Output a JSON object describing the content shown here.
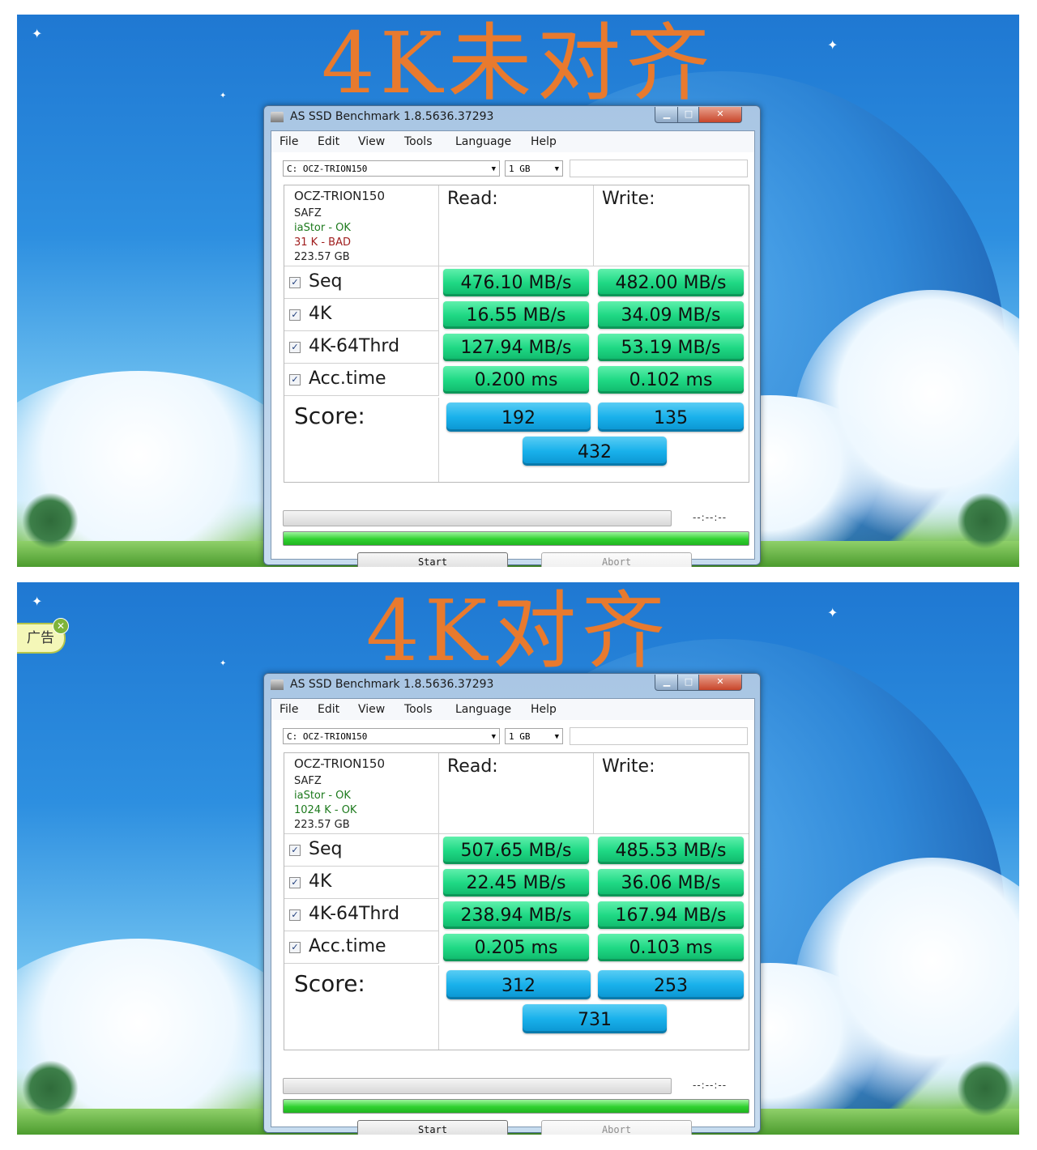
{
  "panels": [
    {
      "banner": "4K未对齐",
      "window": {
        "title": "AS SSD Benchmark 1.8.5636.37293",
        "menu": [
          "File",
          "Edit",
          "View",
          "Tools",
          "Language",
          "Help"
        ],
        "drive_select": "C: OCZ-TRION150",
        "size_select": "1 GB",
        "info": [
          "OCZ-TRION150",
          "SAFZ",
          "iaStor - OK",
          "31 K - BAD",
          "223.57 GB"
        ],
        "info_colors": [
          "#222222",
          "#222222",
          "#1d7a1d",
          "#a01e1e",
          "#222222"
        ],
        "read_header": "Read:",
        "write_header": "Write:",
        "rows": [
          {
            "label": "Seq",
            "read": "476.10 MB/s",
            "write": "482.00 MB/s"
          },
          {
            "label": "4K",
            "read": "16.55 MB/s",
            "write": "34.09 MB/s"
          },
          {
            "label": "4K-64Thrd",
            "read": "127.94 MB/s",
            "write": "53.19 MB/s"
          },
          {
            "label": "Acc.time",
            "read": "0.200 ms",
            "write": "0.102 ms"
          }
        ],
        "score_label": "Score:",
        "score_read": "192",
        "score_write": "135",
        "score_total": "432",
        "time": "--:--:--",
        "start_label": "Start",
        "abort_label": "Abort"
      }
    },
    {
      "banner": "4K对齐",
      "ad_label": "广告",
      "window": {
        "title": "AS SSD Benchmark 1.8.5636.37293",
        "menu": [
          "File",
          "Edit",
          "View",
          "Tools",
          "Language",
          "Help"
        ],
        "drive_select": "C: OCZ-TRION150",
        "size_select": "1 GB",
        "info": [
          "OCZ-TRION150",
          "SAFZ",
          "iaStor - OK",
          "1024 K - OK",
          "223.57 GB"
        ],
        "info_colors": [
          "#222222",
          "#222222",
          "#1d7a1d",
          "#1d7a1d",
          "#222222"
        ],
        "read_header": "Read:",
        "write_header": "Write:",
        "rows": [
          {
            "label": "Seq",
            "read": "507.65 MB/s",
            "write": "485.53 MB/s"
          },
          {
            "label": "4K",
            "read": "22.45 MB/s",
            "write": "36.06 MB/s"
          },
          {
            "label": "4K-64Thrd",
            "read": "238.94 MB/s",
            "write": "167.94 MB/s"
          },
          {
            "label": "Acc.time",
            "read": "0.205 ms",
            "write": "0.103 ms"
          }
        ],
        "score_label": "Score:",
        "score_read": "312",
        "score_write": "253",
        "score_total": "731",
        "time": "--:--:--",
        "start_label": "Start",
        "abort_label": "Abort"
      }
    }
  ]
}
